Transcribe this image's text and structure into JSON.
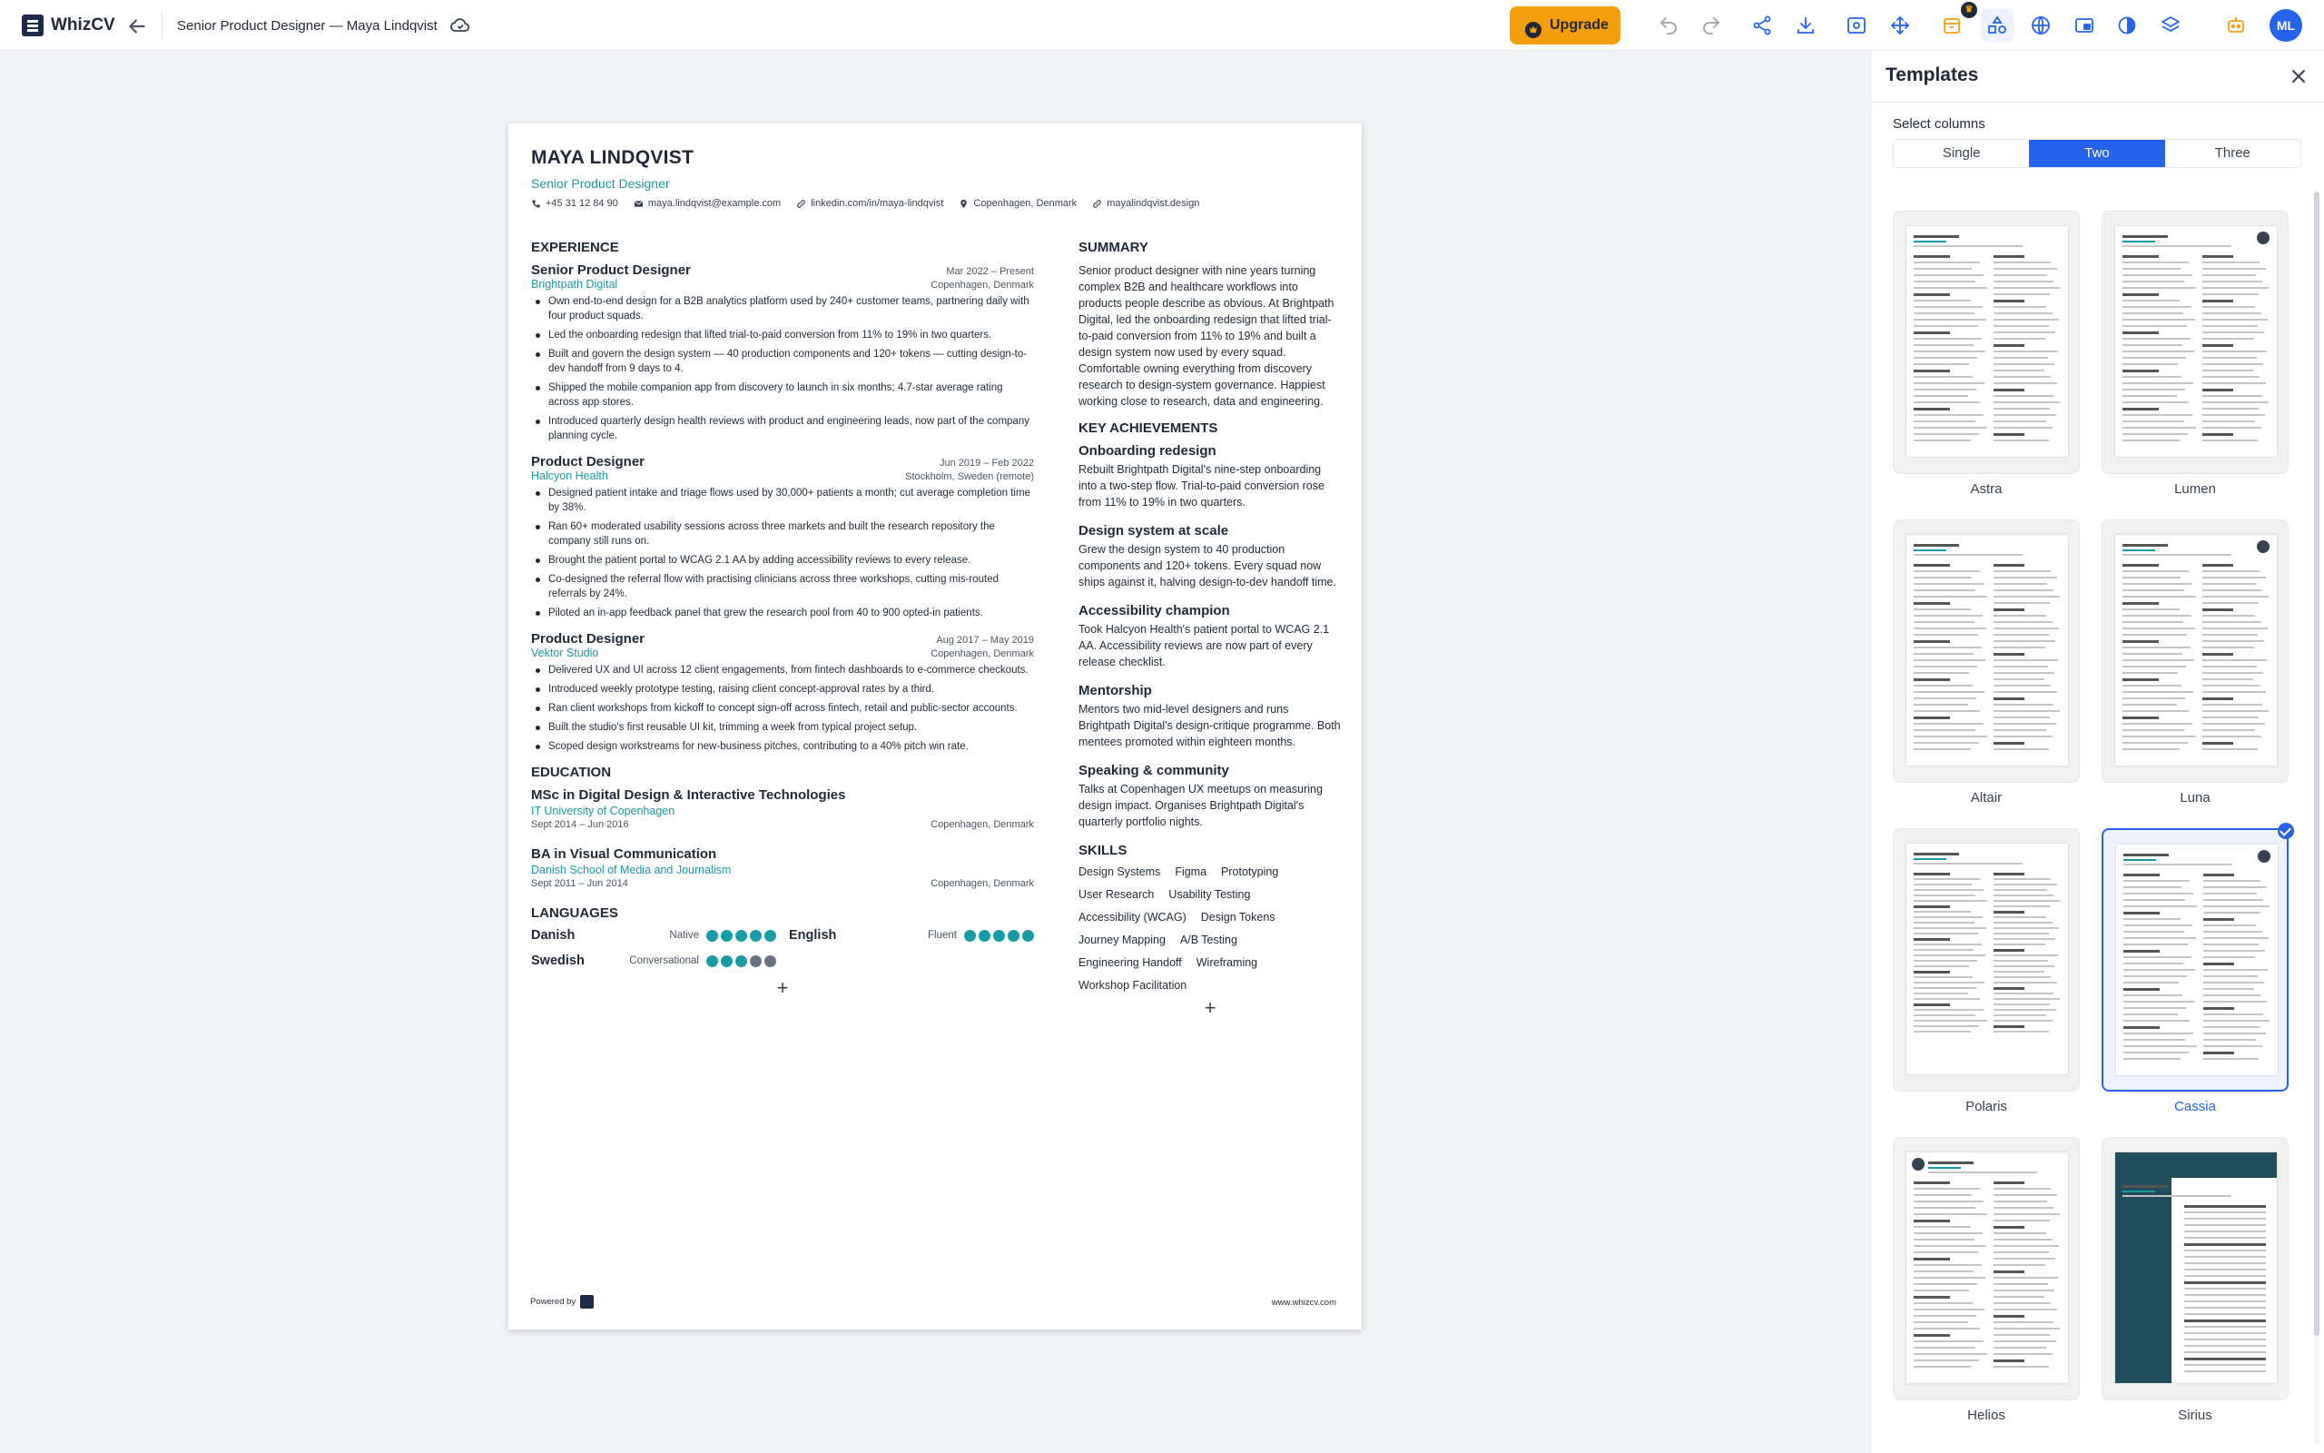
{
  "app": {
    "brand": "WhizCV",
    "doc_title": "Senior Product Designer — Maya Lindqvist",
    "upgrade_label": "Upgrade",
    "avatar_initials": "ML",
    "accent": "#2563eb",
    "upgrade_color": "#f59e0b"
  },
  "resume": {
    "name": "MAYA LINDQVIST",
    "role": "Senior Product Designer",
    "contacts": {
      "phone": "+45 31 12 84 90",
      "email": "maya.lindqvist@example.com",
      "linkedin": "linkedin.com/in/maya-lindqvist",
      "location": "Copenhagen, Denmark",
      "website": "mayalindqvist.design"
    },
    "experience_heading": "EXPERIENCE",
    "jobs": [
      {
        "title": "Senior Product Designer",
        "dates": "Mar 2022 – Present",
        "company": "Brightpath Digital",
        "location": "Copenhagen, Denmark",
        "bullets": [
          "Own end-to-end design for a B2B analytics platform used by 240+ customer teams, partnering daily with four product squads.",
          "Led the onboarding redesign that lifted trial-to-paid conversion from 11% to 19% in two quarters.",
          "Built and govern the design system — 40 production components and 120+ tokens — cutting design-to-dev handoff from 9 days to 4.",
          "Shipped the mobile companion app from discovery to launch in six months; 4.7-star average rating across app stores.",
          "Introduced quarterly design health reviews with product and engineering leads, now part of the company planning cycle."
        ]
      },
      {
        "title": "Product Designer",
        "dates": "Jun 2019 – Feb 2022",
        "company": "Halcyon Health",
        "location": "Stockholm, Sweden (remote)",
        "bullets": [
          "Designed patient intake and triage flows used by 30,000+ patients a month; cut average completion time by 38%.",
          "Ran 60+ moderated usability sessions across three markets and built the research repository the company still runs on.",
          "Brought the patient portal to WCAG 2.1 AA by adding accessibility reviews to every release.",
          "Co-designed the referral flow with practising clinicians across three workshops, cutting mis-routed referrals by 24%.",
          "Piloted an in-app feedback panel that grew the research pool from 40 to 900 opted-in patients."
        ]
      },
      {
        "title": "Product Designer",
        "dates": "Aug 2017 – May 2019",
        "company": "Vektor Studio",
        "location": "Copenhagen, Denmark",
        "bullets": [
          "Delivered UX and UI across 12 client engagements, from fintech dashboards to e-commerce checkouts.",
          "Introduced weekly prototype testing, raising client concept-approval rates by a third.",
          "Ran client workshops from kickoff to concept sign-off across fintech, retail and public-sector accounts.",
          "Built the studio's first reusable UI kit, trimming a week from typical project setup.",
          "Scoped design workstreams for new-business pitches, contributing to a 40% pitch win rate."
        ]
      }
    ],
    "education_heading": "EDUCATION",
    "education": [
      {
        "degree": "MSc in Digital Design & Interactive Technologies",
        "school": "IT University of Copenhagen",
        "dates": "Sept 2014 – Jun 2016",
        "location": "Copenhagen, Denmark"
      },
      {
        "degree": "BA in Visual Communication",
        "school": "Danish School of Media and Journalism",
        "dates": "Sept 2011 – Jun 2014",
        "location": "Copenhagen, Denmark"
      }
    ],
    "languages_heading": "LANGUAGES",
    "languages": [
      {
        "name": "Danish",
        "level": "Native",
        "rating": 5
      },
      {
        "name": "English",
        "level": "Fluent",
        "rating": 5
      },
      {
        "name": "Swedish",
        "level": "Conversational",
        "rating": 3
      }
    ],
    "summary_heading": "SUMMARY",
    "summary": "Senior product designer with nine years turning complex B2B and healthcare workflows into products people describe as obvious. At Brightpath Digital, led the onboarding redesign that lifted trial-to-paid conversion from 11% to 19% and built a design system now used by every squad. Comfortable owning everything from discovery research to design-system governance. Happiest working close to research, data and engineering.",
    "achievements_heading": "KEY ACHIEVEMENTS",
    "achievements": [
      {
        "title": "Onboarding redesign",
        "text": "Rebuilt Brightpath Digital's nine-step onboarding into a two-step flow. Trial-to-paid conversion rose from 11% to 19% in two quarters."
      },
      {
        "title": "Design system at scale",
        "text": "Grew the design system to 40 production components and 120+ tokens. Every squad now ships against it, halving design-to-dev handoff time."
      },
      {
        "title": "Accessibility champion",
        "text": "Took Halcyon Health's patient portal to WCAG 2.1 AA. Accessibility reviews are now part of every release checklist."
      },
      {
        "title": "Mentorship",
        "text": "Mentors two mid-level designers and runs Brightpath Digital's design-critique programme. Both mentees promoted within eighteen months."
      },
      {
        "title": "Speaking & community",
        "text": "Talks at Copenhagen UX meetups on measuring design impact. Organises Brightpath Digital's quarterly portfolio nights."
      }
    ],
    "skills_heading": "SKILLS",
    "skills": [
      "Design Systems",
      "Figma",
      "Prototyping",
      "User Research",
      "Usability Testing",
      "Accessibility (WCAG)",
      "Design Tokens",
      "Journey Mapping",
      "A/B Testing",
      "Engineering Handoff",
      "Wireframing",
      "Workshop Facilitation"
    ],
    "add_symbol": "+",
    "powered_by": "Powered by",
    "site": "www.whizcv.com"
  },
  "templates_panel": {
    "title": "Templates",
    "select_label": "Select columns",
    "columns": [
      "Single",
      "Two",
      "Three"
    ],
    "active_column": "Two",
    "templates": [
      {
        "name": "Astra"
      },
      {
        "name": "Lumen"
      },
      {
        "name": "Altair"
      },
      {
        "name": "Luna"
      },
      {
        "name": "Polaris"
      },
      {
        "name": "Cassia",
        "selected": true
      },
      {
        "name": "Helios"
      },
      {
        "name": "Sirius"
      }
    ]
  }
}
